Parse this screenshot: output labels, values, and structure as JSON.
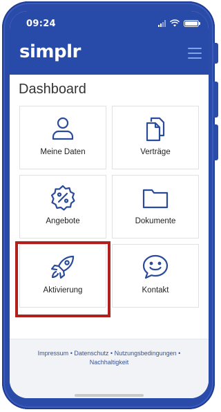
{
  "status_bar": {
    "time": "09:24",
    "signal_icon": "cellular-signal-icon",
    "wifi_icon": "wifi-icon",
    "battery_icon": "battery-icon"
  },
  "header": {
    "logo_text": "simplr",
    "menu_icon": "hamburger-menu-icon",
    "background_color": "#284aa9"
  },
  "dashboard": {
    "title": "Dashboard",
    "tiles": [
      {
        "label": "Meine Daten",
        "icon": "user-icon"
      },
      {
        "label": "Verträge",
        "icon": "documents-copy-icon"
      },
      {
        "label": "Angebote",
        "icon": "percent-badge-icon"
      },
      {
        "label": "Dokumente",
        "icon": "folder-icon"
      },
      {
        "label": "Aktivierung",
        "icon": "rocket-icon",
        "highlighted": true
      },
      {
        "label": "Kontakt",
        "icon": "chat-smile-icon"
      }
    ],
    "highlight_color": "#b0211d",
    "icon_color": "#2a4a9a"
  },
  "footer": {
    "links": [
      "Impressum",
      "Datenschutz",
      "Nutzungsbedingungen",
      "Nachhaltigkeit"
    ],
    "separator": "•"
  }
}
